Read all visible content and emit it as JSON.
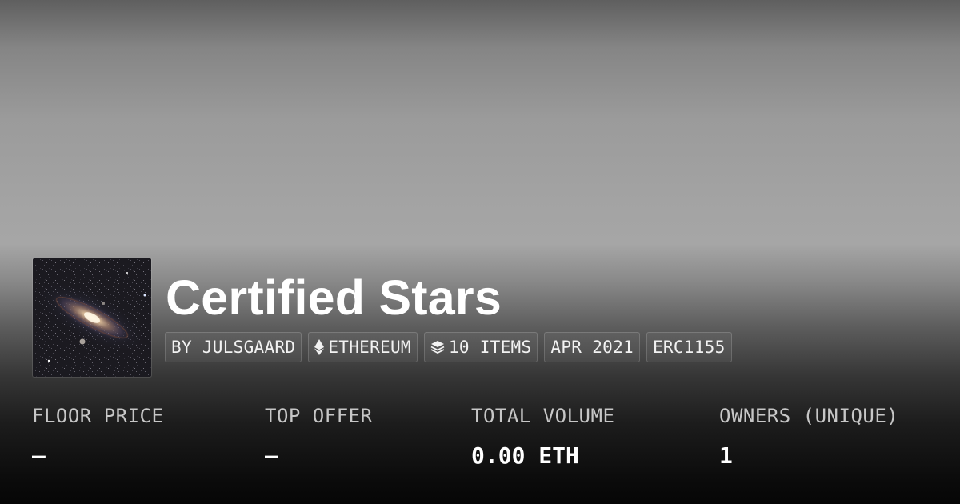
{
  "collection": {
    "title": "Certified Stars",
    "thumbnail_alt": "galaxy-image"
  },
  "tags": {
    "creator": "BY JULSGAARD",
    "chain": "ETHEREUM",
    "chain_icon": "ethereum-icon",
    "items": "10 ITEMS",
    "items_icon": "layers-icon",
    "date": "APR 2021",
    "standard": "ERC1155"
  },
  "stats": {
    "floor_price_label": "FLOOR PRICE",
    "floor_price_value": "—",
    "top_offer_label": "TOP OFFER",
    "top_offer_value": "—",
    "total_volume_label": "TOTAL VOLUME",
    "total_volume_value": "0.00 ETH",
    "owners_label": "OWNERS (UNIQUE)",
    "owners_value": "1"
  },
  "colors": {
    "background_top": "#5f5f5f",
    "background_mid": "#a6a6a6",
    "background_bottom": "#060606",
    "text_primary": "#ffffff",
    "text_secondary": "#c7c7c7"
  }
}
